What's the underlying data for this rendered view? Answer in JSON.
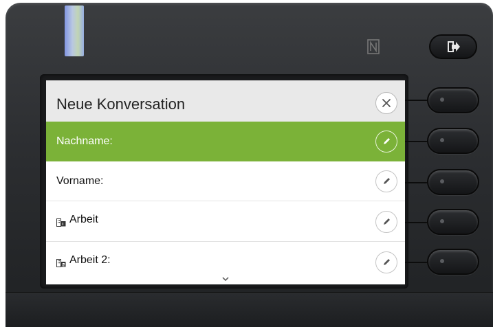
{
  "screen": {
    "title": "Neue Konversation",
    "rows": [
      {
        "label": "Nachname:",
        "icon": null,
        "selected": true
      },
      {
        "label": "Vorname:",
        "icon": null,
        "selected": false
      },
      {
        "label": "Arbeit",
        "icon": "work-phone-icon",
        "selected": false
      },
      {
        "label": "Arbeit 2:",
        "icon": "work-phone-2-icon",
        "selected": false
      }
    ]
  },
  "colors": {
    "selected_row": "#7bb238",
    "header_bg": "#e9e9e9",
    "phone_body": "#2c2e31"
  },
  "icons": {
    "close": "close-icon",
    "edit": "pencil-icon",
    "exit": "exit-arrow-icon",
    "nfc": "nfc-icon",
    "scroll": "chevron-down-icon"
  }
}
